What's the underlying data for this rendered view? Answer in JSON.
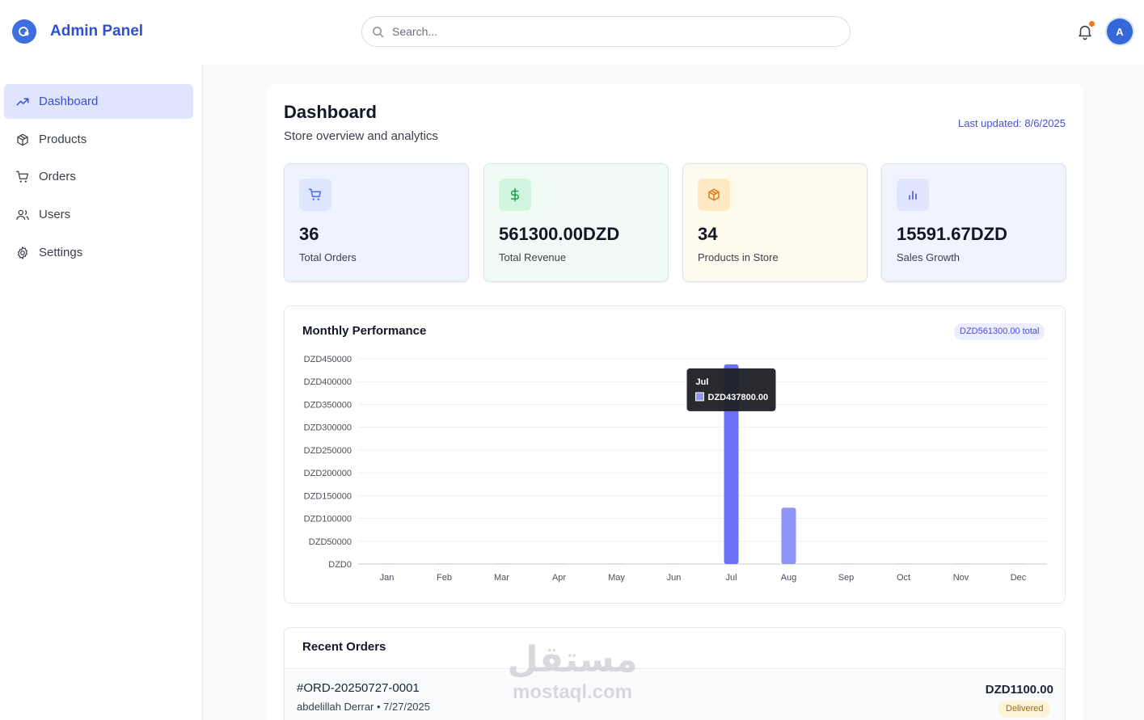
{
  "header": {
    "brand": "Admin Panel",
    "search_placeholder": "Search...",
    "avatar_initial": "A"
  },
  "sidebar": {
    "items": [
      {
        "label": "Dashboard",
        "icon": "trending-up-icon",
        "active": true
      },
      {
        "label": "Products",
        "icon": "package-icon"
      },
      {
        "label": "Orders",
        "icon": "cart-icon"
      },
      {
        "label": "Users",
        "icon": "users-icon"
      },
      {
        "label": "Settings",
        "icon": "gear-icon"
      }
    ]
  },
  "page": {
    "title": "Dashboard",
    "subtitle": "Store overview and analytics",
    "last_updated": "Last updated: 8/6/2025"
  },
  "stats": [
    {
      "value": "36",
      "label": "Total Orders",
      "icon": "cart-icon",
      "color": "#4a6cf0",
      "bg": "#eef3fe",
      "icon_bg": "#dde6fd"
    },
    {
      "value": "561300.00DZD",
      "label": "Total Revenue",
      "icon": "dollar-icon",
      "color": "#1e9c4d",
      "bg": "#effbf4",
      "icon_bg": "#d3f5df"
    },
    {
      "value": "34",
      "label": "Products in Store",
      "icon": "package-icon",
      "color": "#e2780e",
      "bg": "#fffaee",
      "icon_bg": "#ffe9c2"
    },
    {
      "value": "15591.67DZD",
      "label": "Sales Growth",
      "icon": "bar-chart-icon",
      "color": "#4a54e0",
      "bg": "#f1f4fe",
      "icon_bg": "#e0e6fd"
    }
  ],
  "chart_card": {
    "title": "Monthly Performance",
    "badge": "DZD561300.00 total"
  },
  "chart_data": {
    "type": "bar",
    "title": "Monthly Performance",
    "categories": [
      "Jan",
      "Feb",
      "Mar",
      "Apr",
      "May",
      "Jun",
      "Jul",
      "Aug",
      "Sep",
      "Oct",
      "Nov",
      "Dec"
    ],
    "values": [
      0,
      0,
      0,
      0,
      0,
      0,
      437800,
      123500,
      0,
      0,
      0,
      0
    ],
    "ylim": [
      0,
      450000
    ],
    "yticks": [
      0,
      50000,
      100000,
      150000,
      200000,
      250000,
      300000,
      350000,
      400000,
      450000
    ],
    "tick_prefix": "DZD",
    "grid": true,
    "colors": {
      "bar": "#8f94f8",
      "bar_active": "#6c70f7"
    },
    "tooltip": {
      "month": "Jul",
      "text": "DZD437800.00"
    }
  },
  "orders": {
    "title": "Recent Orders",
    "rows": [
      {
        "id": "#ORD-20250727-0001",
        "meta": "abdelillah Derrar • 7/27/2025",
        "amount": "DZD1100.00",
        "status": "Delivered"
      }
    ]
  },
  "watermark": {
    "arabic": "مستقل",
    "latin": "mostaql.com"
  }
}
